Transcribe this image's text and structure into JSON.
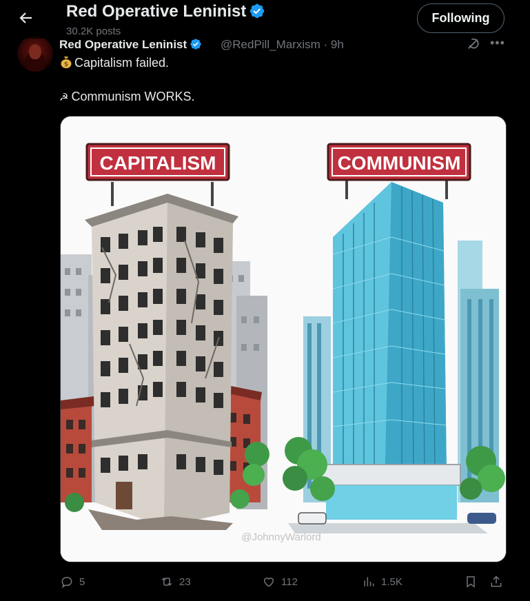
{
  "topbar": {
    "name": "Red Operative Leninist",
    "posts_count": "30.2K posts",
    "follow_label": "Following"
  },
  "post": {
    "author_name": "Red Operative Leninist",
    "handle_time": "@RedPill_Marxism · 9h",
    "line1": "Capitalism failed.",
    "line2": "Communism WORKS."
  },
  "media": {
    "left_sign": "CAPITALISM",
    "right_sign": "COMMUNISM",
    "watermark": "@JohnnyWarlord"
  },
  "actions": {
    "replies": "5",
    "reposts": "23",
    "likes": "112",
    "views": "1.5K"
  },
  "colors": {
    "verified": "#1d9bf0",
    "sign_red": "#c0303e",
    "glass": "#5fc4de"
  }
}
